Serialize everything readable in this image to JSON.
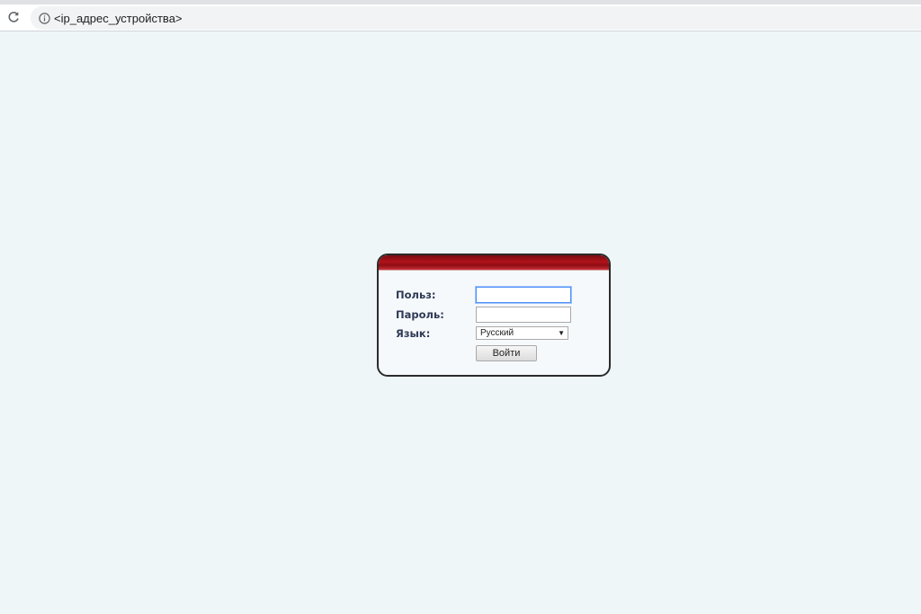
{
  "browser": {
    "url": "<ip_адрес_устройства>",
    "icons": {
      "reload": "reload-icon",
      "info": "info-icon"
    }
  },
  "login": {
    "user_label": "Польз:",
    "user_value": "",
    "password_label": "Пароль:",
    "password_value": "",
    "language_label": "Язык:",
    "language_selected": "Русский",
    "submit_label": "Войти",
    "header_color": "#b0121a",
    "focus_color": "#4d90fe"
  }
}
